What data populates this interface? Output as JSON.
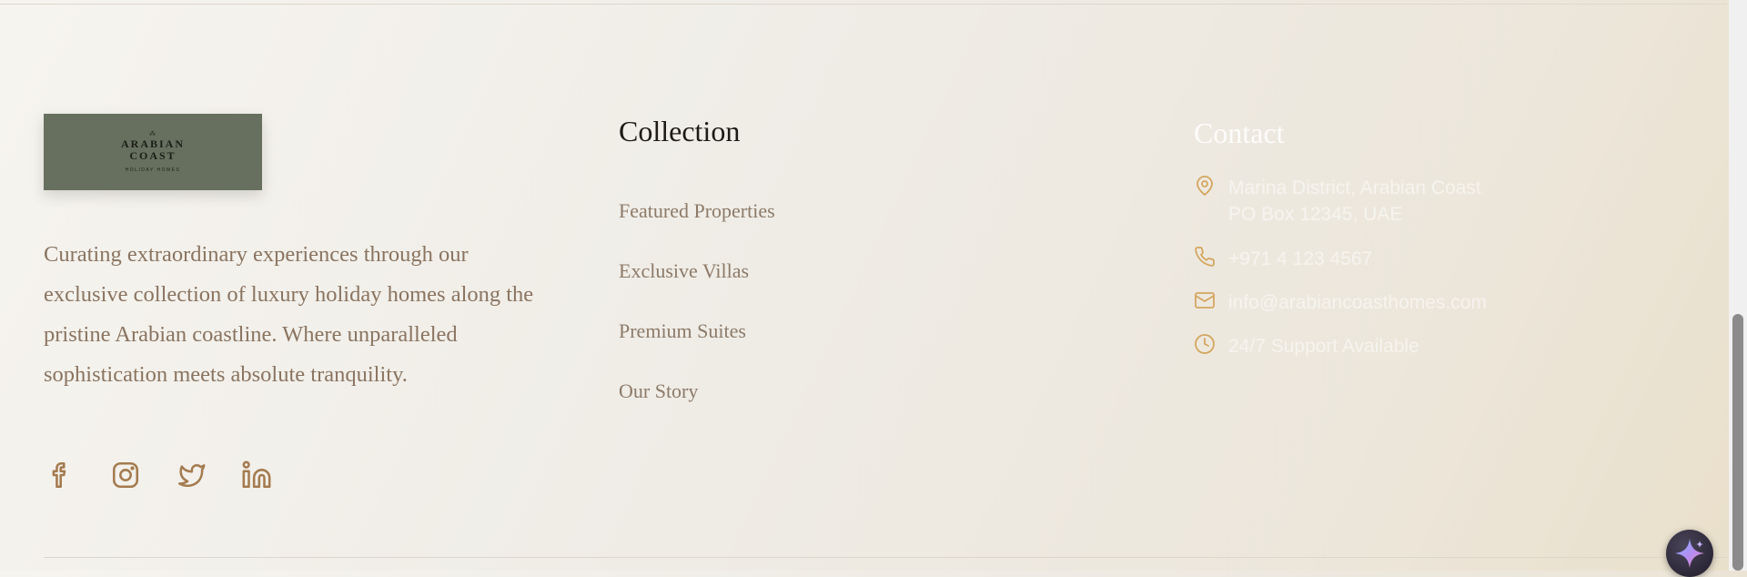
{
  "brand": {
    "logo": {
      "mark": "⁂",
      "line1": "ARABIAN",
      "line2": "COAST",
      "tagline": "HOLIDAY HOMES"
    },
    "description": "Curating extraordinary experiences through our exclusive collection of luxury holiday homes along the pristine Arabian coastline. Where unparalleled sophistication meets absolute tranquility.",
    "social": [
      {
        "icon": "facebook-icon"
      },
      {
        "icon": "instagram-icon"
      },
      {
        "icon": "twitter-icon"
      },
      {
        "icon": "linkedin-icon"
      }
    ]
  },
  "collection": {
    "title": "Collection",
    "links": [
      {
        "label": "Featured Properties"
      },
      {
        "label": "Exclusive Villas"
      },
      {
        "label": "Premium Suites"
      },
      {
        "label": "Our Story"
      }
    ]
  },
  "contact": {
    "title": "Contact",
    "address_line1": "Marina District, Arabian Coast",
    "address_line2": "PO Box 12345, UAE",
    "phone": "+971 4 123 4567",
    "email": "info@arabiancoasthomes.com",
    "hours": "24/7 Support Available"
  },
  "colors": {
    "accent": "#a47b4f",
    "contact_icon": "#d4a65f",
    "logo_bg": "#67705f"
  }
}
